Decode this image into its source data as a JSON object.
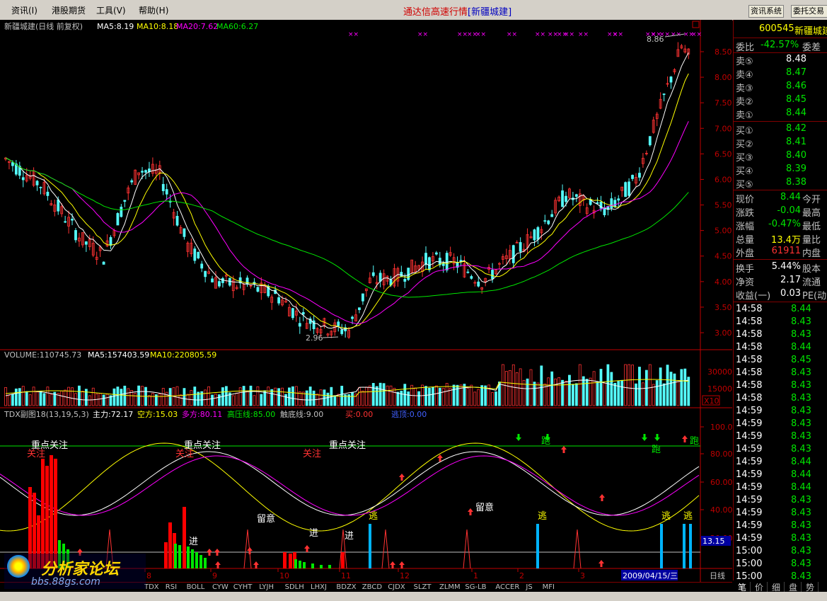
{
  "menu": {
    "items": [
      "资讯(I)",
      "港股期货",
      "工具(V)",
      "帮助(H)"
    ],
    "title_prefix": "通达信高速行情",
    "title_stock": "[新疆城建]",
    "btn_info": "资讯系统",
    "btn_trade": "委托交易"
  },
  "chart_header": {
    "label": "新疆城建(日线 前复权)",
    "ma5": "MA5:8.19",
    "ma10": "MA10:8.18",
    "ma20": "MA20:7.62",
    "ma60": "MA60:6.27"
  },
  "volume_header": {
    "label": "VOLUME:110745.73",
    "ma5": "MA5:157403.59",
    "ma10": "MA10:220805.59"
  },
  "indicator_header": {
    "label": "TDX副图18(13,19,5,3)",
    "zhuli": "主力:72.17",
    "kongfang": "空方:15.03",
    "duofang": "多方:80.11",
    "gaoya": "高压线:85.00",
    "chudi": "触底线:9.00",
    "mai": "买:0.00",
    "taopao": "逃顶:0.00"
  },
  "price_axis": [
    "8.50",
    "8.00",
    "7.50",
    "7.00",
    "6.50",
    "6.00",
    "5.50",
    "5.00",
    "4.50",
    "4.00",
    "3.50",
    "3.00"
  ],
  "volume_axis": [
    "30000",
    "15000",
    "X10"
  ],
  "ind_axis": [
    "100.0",
    "80.00",
    "60.00",
    "40.00",
    "20.00"
  ],
  "ind_current": "13.15",
  "annotations": {
    "high": "8.86",
    "low": "2.96"
  },
  "ind_labels": {
    "focus": "重点关注",
    "attention": "关注",
    "watch": "留意",
    "enter": "进",
    "escape": "逃",
    "run": "跑"
  },
  "month_labels": [
    "8",
    "9",
    "10",
    "11",
    "12",
    "1",
    "2",
    "3"
  ],
  "date_box": "2009/04/15/三",
  "period": "日线",
  "colors": {
    "up": "#ff3232",
    "down": "#54fcfc",
    "ma5": "#ffffff",
    "ma10": "#ffff00",
    "ma20": "#ff00ff",
    "ma60": "#00e600",
    "axis": "#c00000"
  },
  "quote": {
    "code": "600545",
    "name": "新疆城建",
    "weibi_label": "委比",
    "weibi": "-42.57%",
    "weicha_label": "委差",
    "asks": [
      {
        "l": "卖⑤",
        "p": "8.48"
      },
      {
        "l": "卖④",
        "p": "8.47"
      },
      {
        "l": "卖③",
        "p": "8.46"
      },
      {
        "l": "卖②",
        "p": "8.45"
      },
      {
        "l": "卖①",
        "p": "8.44"
      }
    ],
    "bids": [
      {
        "l": "买①",
        "p": "8.42"
      },
      {
        "l": "买②",
        "p": "8.41"
      },
      {
        "l": "买③",
        "p": "8.40"
      },
      {
        "l": "买④",
        "p": "8.39"
      },
      {
        "l": "买⑤",
        "p": "8.38"
      }
    ],
    "stats": [
      {
        "l": "现价",
        "v": "8.44",
        "x": "今开"
      },
      {
        "l": "涨跌",
        "v": "-0.04",
        "x": "最高"
      },
      {
        "l": "涨幅",
        "v": "-0.47%",
        "x": "最低"
      },
      {
        "l": "总量",
        "v": "13.4万",
        "x": "量比"
      },
      {
        "l": "外盘",
        "v": "61911",
        "x": "内盘"
      }
    ],
    "fin": [
      {
        "l": "换手",
        "v": "5.44%",
        "x": "股本"
      },
      {
        "l": "净资",
        "v": "2.17",
        "x": "流通"
      },
      {
        "l": "收益(一)",
        "v": "0.03",
        "x": "PE(动)"
      }
    ],
    "ticks": [
      [
        "14:58",
        "8.44"
      ],
      [
        "14:58",
        "8.43"
      ],
      [
        "14:58",
        "8.43"
      ],
      [
        "14:58",
        "8.44"
      ],
      [
        "14:58",
        "8.45"
      ],
      [
        "14:58",
        "8.43"
      ],
      [
        "14:58",
        "8.43"
      ],
      [
        "14:58",
        "8.43"
      ],
      [
        "14:59",
        "8.43"
      ],
      [
        "14:59",
        "8.43"
      ],
      [
        "14:59",
        "8.43"
      ],
      [
        "14:59",
        "8.43"
      ],
      [
        "14:59",
        "8.44"
      ],
      [
        "14:59",
        "8.44"
      ],
      [
        "14:59",
        "8.44"
      ],
      [
        "14:59",
        "8.43"
      ],
      [
        "14:59",
        "8.43"
      ],
      [
        "14:59",
        "8.43"
      ],
      [
        "14:59",
        "8.43"
      ],
      [
        "15:00",
        "8.43"
      ],
      [
        "15:00",
        "8.43"
      ],
      [
        "15:00",
        "8.43"
      ],
      [
        "15:00",
        "8.44"
      ]
    ]
  },
  "bottom_tabs": [
    "TDX",
    "RSI",
    "BOLL",
    "CYW",
    "CYHT",
    "LYJH",
    "SDLH",
    "LHXJ",
    "BDZX",
    "ZBCD",
    "CJDX",
    "SLZT",
    "ZLMM",
    "SG-LB",
    "ACCER",
    "JS",
    "MFI"
  ],
  "right_tabs": [
    "笔",
    "价",
    "细",
    "盘",
    "势"
  ],
  "watermark": {
    "text": "分析家论坛",
    "url": "bbs.88gs.com"
  }
}
